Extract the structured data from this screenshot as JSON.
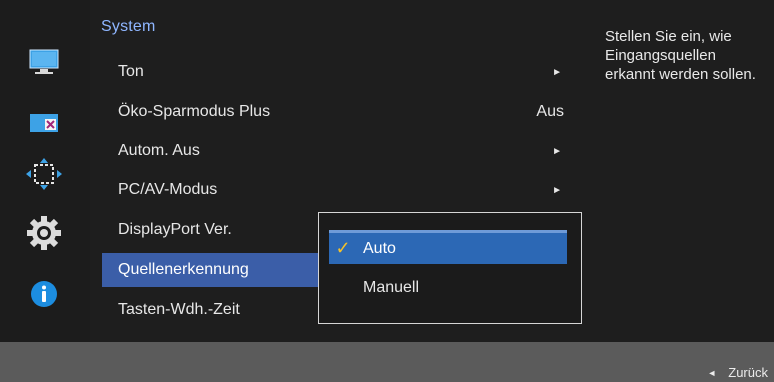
{
  "menu": {
    "title": "System",
    "items": [
      {
        "label": "Ton",
        "value": "",
        "arrow": "►"
      },
      {
        "label": "Öko-Sparmodus Plus",
        "value": "Aus",
        "arrow": ""
      },
      {
        "label": "Autom. Aus",
        "value": "",
        "arrow": "►"
      },
      {
        "label": "PC/AV-Modus",
        "value": "",
        "arrow": "►"
      },
      {
        "label": "DisplayPort Ver.",
        "value": "",
        "arrow": ""
      },
      {
        "label": "Quellenerkennung",
        "value": "",
        "arrow": ""
      },
      {
        "label": "Tasten-Wdh.-Zeit",
        "value": "",
        "arrow": ""
      }
    ],
    "selected_index": 5
  },
  "dropdown": {
    "options": [
      {
        "label": "Auto",
        "checked": "✓"
      },
      {
        "label": "Manuell",
        "checked": ""
      }
    ]
  },
  "help": {
    "text": "Stellen Sie ein, wie Eingangsquellen erkannt werden sollen."
  },
  "footer": {
    "back_label": "Zurück",
    "back_icon": "◄"
  },
  "left_rail": {
    "icons": [
      "picture-icon",
      "screen-size-icon",
      "position-icon",
      "system-gear-icon",
      "info-icon"
    ]
  },
  "colors": {
    "accent_blue": "#3b5ea8",
    "dropdown_selected": "#2c68b5",
    "title_blue": "#8fb6ff",
    "check_yellow": "#f4c12a"
  }
}
